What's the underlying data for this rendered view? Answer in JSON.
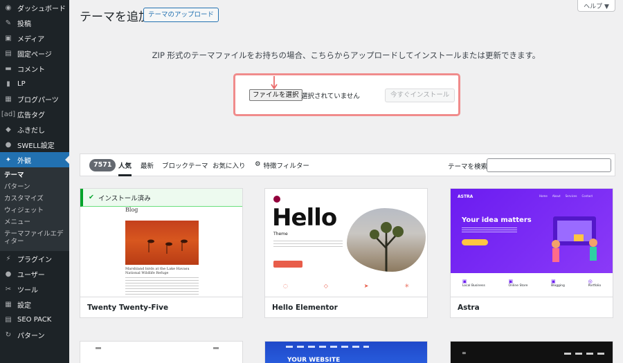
{
  "sidebar": {
    "items": [
      {
        "icon": "dashboard-icon",
        "glyph": "◉",
        "label": "ダッシュボード"
      },
      {
        "icon": "pin-icon",
        "glyph": "✎",
        "label": "投稿"
      },
      {
        "icon": "media-icon",
        "glyph": "▣",
        "label": "メディア"
      },
      {
        "icon": "page-icon",
        "glyph": "▤",
        "label": "固定ページ"
      },
      {
        "icon": "comment-icon",
        "glyph": "▬",
        "label": "コメント"
      },
      {
        "icon": "lp-icon",
        "glyph": "▮",
        "label": "LP"
      },
      {
        "icon": "blog-parts-icon",
        "glyph": "▦",
        "label": "ブログパーツ"
      },
      {
        "icon": "ad-tag-icon",
        "glyph": "[ad]",
        "label": "広告タグ"
      },
      {
        "icon": "balloon-icon",
        "glyph": "◆",
        "label": "ふきだし"
      },
      {
        "icon": "swell-icon",
        "glyph": "●",
        "label": "SWELL設定"
      }
    ],
    "active": {
      "icon": "appearance-icon",
      "glyph": "✦",
      "label": "外観"
    },
    "submenu": [
      "テーマ",
      "パターン",
      "カスタマイズ",
      "ウィジェット",
      "メニュー",
      "テーマファイルエディター"
    ],
    "items_after": [
      {
        "icon": "plugin-icon",
        "glyph": "⚡",
        "label": "プラグイン"
      },
      {
        "icon": "user-icon",
        "glyph": "●",
        "label": "ユーザー"
      },
      {
        "icon": "tools-icon",
        "glyph": "✂",
        "label": "ツール"
      },
      {
        "icon": "settings-icon",
        "glyph": "▦",
        "label": "設定"
      },
      {
        "icon": "seo-pack-icon",
        "glyph": "▤",
        "label": "SEO PACK"
      },
      {
        "icon": "pattern-icon",
        "glyph": "↻",
        "label": "パターン"
      }
    ]
  },
  "header": {
    "title": "テーマを追加",
    "upload_button": "テーマのアップロード",
    "help": "ヘルプ ▼"
  },
  "upload": {
    "description": "ZIP 形式のテーマファイルをお持ちの場合、こちらからアップロードしてインストールまたは更新できます。",
    "choose_file": "ファイルを選択",
    "no_file": "選択されていません",
    "install_now": "今すぐインストール",
    "highlight_color": "#f08b8b"
  },
  "filter": {
    "count": "7571",
    "tabs": [
      "人気",
      "最新",
      "ブロックテーマ",
      "お気に入り"
    ],
    "feature_filter": "特徴フィルター",
    "search_label": "テーマを検索",
    "search_value": ""
  },
  "themes": [
    {
      "name": "Twenty Twenty-Five",
      "installed_notice": "インストール済み",
      "preview": {
        "heading": "Blog",
        "caption": "Marshland birds at the Lake Havasu National Wildlife Refuge"
      }
    },
    {
      "name": "Hello Elementor",
      "preview": {
        "title": "Hello",
        "subtitle": "Theme"
      }
    },
    {
      "name": "Astra",
      "preview": {
        "logo": "ASTRA",
        "headline": "Your idea matters",
        "nav": [
          "Home",
          "About",
          "Services",
          "Contact"
        ],
        "features": [
          "Local Business",
          "Online Store",
          "Blogging",
          "Portfolio"
        ],
        "accent": "#6b1cf0"
      }
    }
  ],
  "second_row": {
    "card2_text": "YOUR WEBSITE"
  }
}
